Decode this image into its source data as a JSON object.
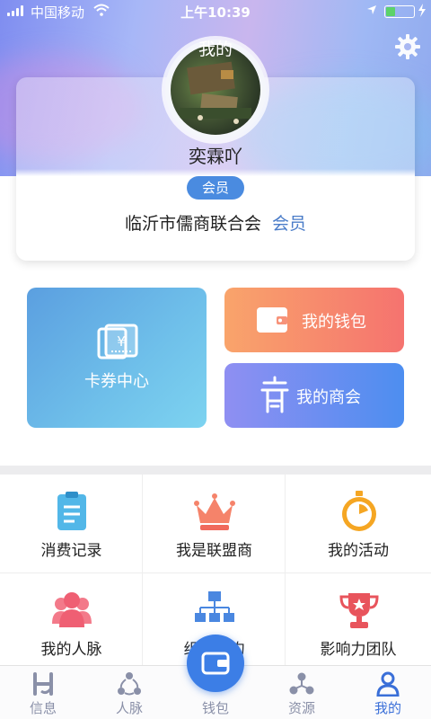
{
  "status_bar": {
    "carrier": "中国移动",
    "time": "上午10:39"
  },
  "header": {
    "title": "我的",
    "settings_icon": "gear-icon"
  },
  "profile": {
    "username": "奕霖吖",
    "badge": "会员",
    "organization": "临沂市儒商联合会",
    "role": "会员"
  },
  "feature_tiles": {
    "coupon": {
      "label": "卡券中心",
      "icon": "ticket-icon"
    },
    "wallet": {
      "label": "我的钱包",
      "icon": "wallet-icon"
    },
    "chamber": {
      "label": "我的商会",
      "icon": "chamber-icon"
    }
  },
  "grid": [
    {
      "label": "消费记录",
      "icon": "clipboard-icon"
    },
    {
      "label": "我是联盟商",
      "icon": "crown-icon"
    },
    {
      "label": "我的活动",
      "icon": "stopwatch-icon"
    },
    {
      "label": "我的人脉",
      "icon": "people-icon"
    },
    {
      "label": "组织架构",
      "icon": "org-chart-icon"
    },
    {
      "label": "影响力团队",
      "icon": "trophy-icon"
    }
  ],
  "bottom_nav": [
    {
      "label": "信息",
      "icon": "info-logo-icon"
    },
    {
      "label": "人脉",
      "icon": "network-icon"
    },
    {
      "label": "钱包",
      "icon": "wallet-icon"
    },
    {
      "label": "资源",
      "icon": "share-icon"
    },
    {
      "label": "我的",
      "icon": "user-icon"
    }
  ],
  "active_tab": "我的",
  "colors": {
    "accent": "#3a6fd8",
    "badge": "#4a8be0",
    "wallet_tile": "#f5736f",
    "chamber_tile": "#4d8ef0",
    "coupon_tile": "#6fc0ea"
  }
}
